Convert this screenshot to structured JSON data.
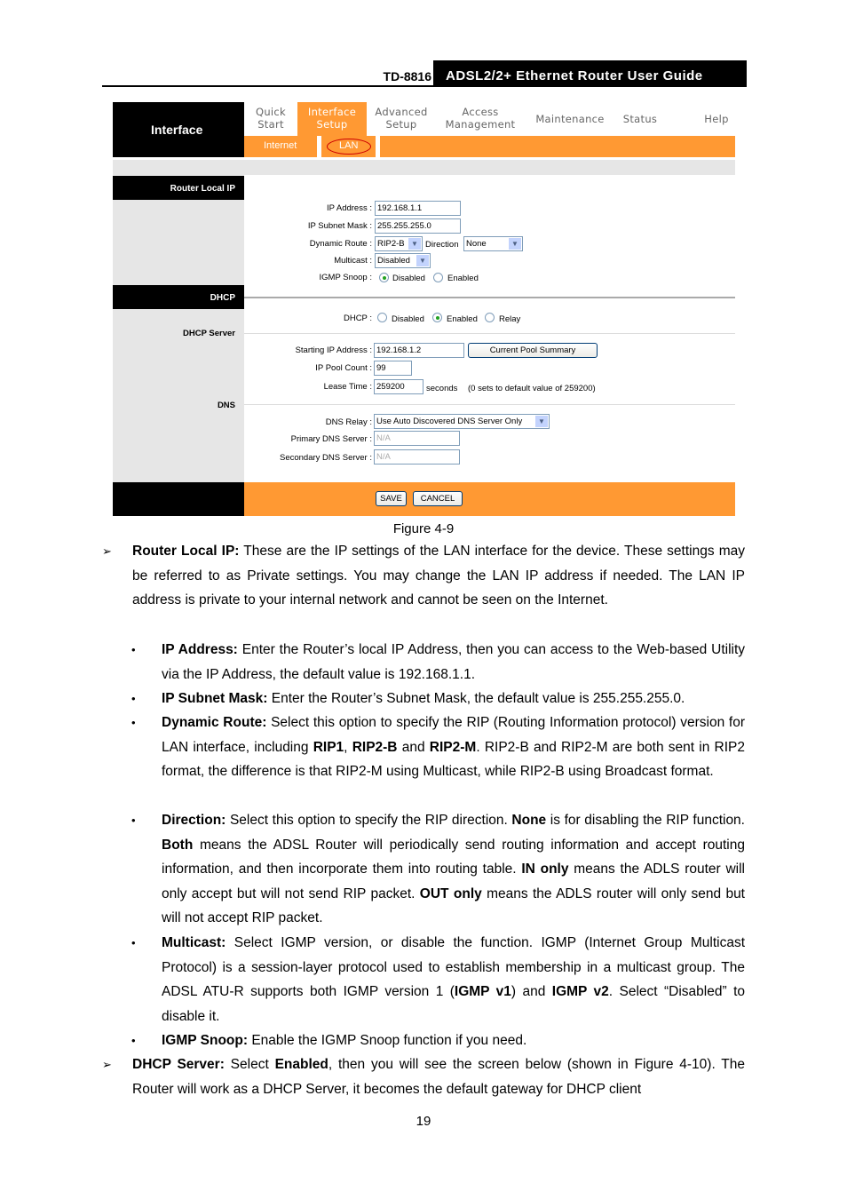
{
  "header": {
    "model": "TD-8816",
    "title": "ADSL2/2+ Ethernet Router User Guide"
  },
  "figure": {
    "brand": "Interface",
    "nav": [
      {
        "line1": "Quick",
        "line2": "Start"
      },
      {
        "line1": "Interface",
        "line2": "Setup",
        "active": true
      },
      {
        "line1": "Advanced",
        "line2": "Setup"
      },
      {
        "line1": "Access",
        "line2": "Management"
      },
      {
        "line1": "Maintenance",
        "line2": ""
      },
      {
        "line1": "Status",
        "line2": ""
      },
      {
        "line1": "Help",
        "line2": ""
      }
    ],
    "subnav": [
      "Internet",
      "LAN"
    ],
    "sections": {
      "router_local_ip": "Router Local IP",
      "dhcp": "DHCP",
      "dhcp_server": "DHCP Server",
      "dns": "DNS"
    },
    "fields": {
      "ip_address": {
        "label": "IP Address :",
        "value": "192.168.1.1"
      },
      "subnet_mask": {
        "label": "IP Subnet Mask :",
        "value": "255.255.255.0"
      },
      "dynamic_route": {
        "label": "Dynamic Route :",
        "value": "RIP2-B"
      },
      "direction": {
        "label": "Direction",
        "value": "None"
      },
      "multicast": {
        "label": "Multicast :",
        "value": "Disabled"
      },
      "igmp_snoop": {
        "label": "IGMP Snoop :",
        "options": [
          "Disabled",
          "Enabled"
        ],
        "selected": "Disabled"
      },
      "dhcp": {
        "label": "DHCP :",
        "options": [
          "Disabled",
          "Enabled",
          "Relay"
        ],
        "selected": "Enabled"
      },
      "starting_ip": {
        "label": "Starting IP Address :",
        "value": "192.168.1.2"
      },
      "pool_summary_button": "Current Pool Summary",
      "pool_count": {
        "label": "IP Pool Count :",
        "value": "99"
      },
      "lease_time": {
        "label": "Lease Time :",
        "value": "259200",
        "unit": "seconds",
        "hint": "(0 sets to default value of 259200)"
      },
      "dns_relay": {
        "label": "DNS Relay :",
        "value": "Use Auto Discovered DNS Server Only"
      },
      "primary_dns": {
        "label": "Primary DNS Server :",
        "value": "N/A"
      },
      "secondary_dns": {
        "label": "Secondary DNS Server :",
        "value": "N/A"
      }
    },
    "buttons": {
      "save": "SAVE",
      "cancel": "CANCEL"
    },
    "caption": "Figure 4-9"
  },
  "body": {
    "p1_bold": "Router Local IP:",
    "p1": " These are the IP settings of the LAN interface for the device. These settings may be referred to as Private settings. You may change the LAN IP address if needed. The LAN IP address is private to your internal network and cannot be seen on the Internet.",
    "b1_bold": "IP Address:",
    "b1": " Enter the Router’s local IP Address, then you can access to the Web-based Utility via the IP Address, the default value is 192.168.1.1.",
    "b2_bold": "IP Subnet Mask:",
    "b2": " Enter the Router’s Subnet Mask, the default value is 255.255.255.0.",
    "b3_bold": "Dynamic Route:",
    "b3a": " Select this option to specify the RIP (Routing Information protocol) version for LAN interface, including ",
    "b3_rip1": "RIP1",
    "b3_rip2b": "RIP2-B",
    "b3_and": " and ",
    "b3_rip2m": "RIP2-M",
    "b3b": ". RIP2-B and RIP2-M are both sent in RIP2 format, the difference is that RIP2-M using Multicast, while RIP2-B using Broadcast format.",
    "b4_bold": "Direction:",
    "b4a": " Select this option to specify the RIP direction. ",
    "b4_none": "None",
    "b4b": " is for disabling the RIP function. ",
    "b4_both": "Both",
    "b4c": " means the ADSL Router will periodically send routing information and accept routing information, and then incorporate them into routing table. ",
    "b4_in": "IN only",
    "b4d": " means the ADLS router will only accept but will not send RIP packet. ",
    "b4_out": "OUT only",
    "b4e": " means the ADLS router will only send but will not accept RIP packet.",
    "b5_bold": "Multicast:",
    "b5a": " Select IGMP version, or disable the function. IGMP (Internet Group Multicast Protocol) is a session-layer protocol used to establish membership in a multicast group. The ADSL ATU-R supports both IGMP version 1 (",
    "b5_v1": "IGMP v1",
    "b5b": ") and ",
    "b5_v2": "IGMP v2",
    "b5c": ". Select “Disabled” to disable it.",
    "b6_bold": "IGMP Snoop:",
    "b6": " Enable the IGMP Snoop function if you need.",
    "p2_bold": "DHCP Server:",
    "p2a": " Select ",
    "p2_enabled": "Enabled",
    "p2b": ", then you will see the screen below (shown in Figure 4-10). The Router will work as a DHCP Server, it becomes the default gateway for DHCP client"
  },
  "page_number": "19"
}
